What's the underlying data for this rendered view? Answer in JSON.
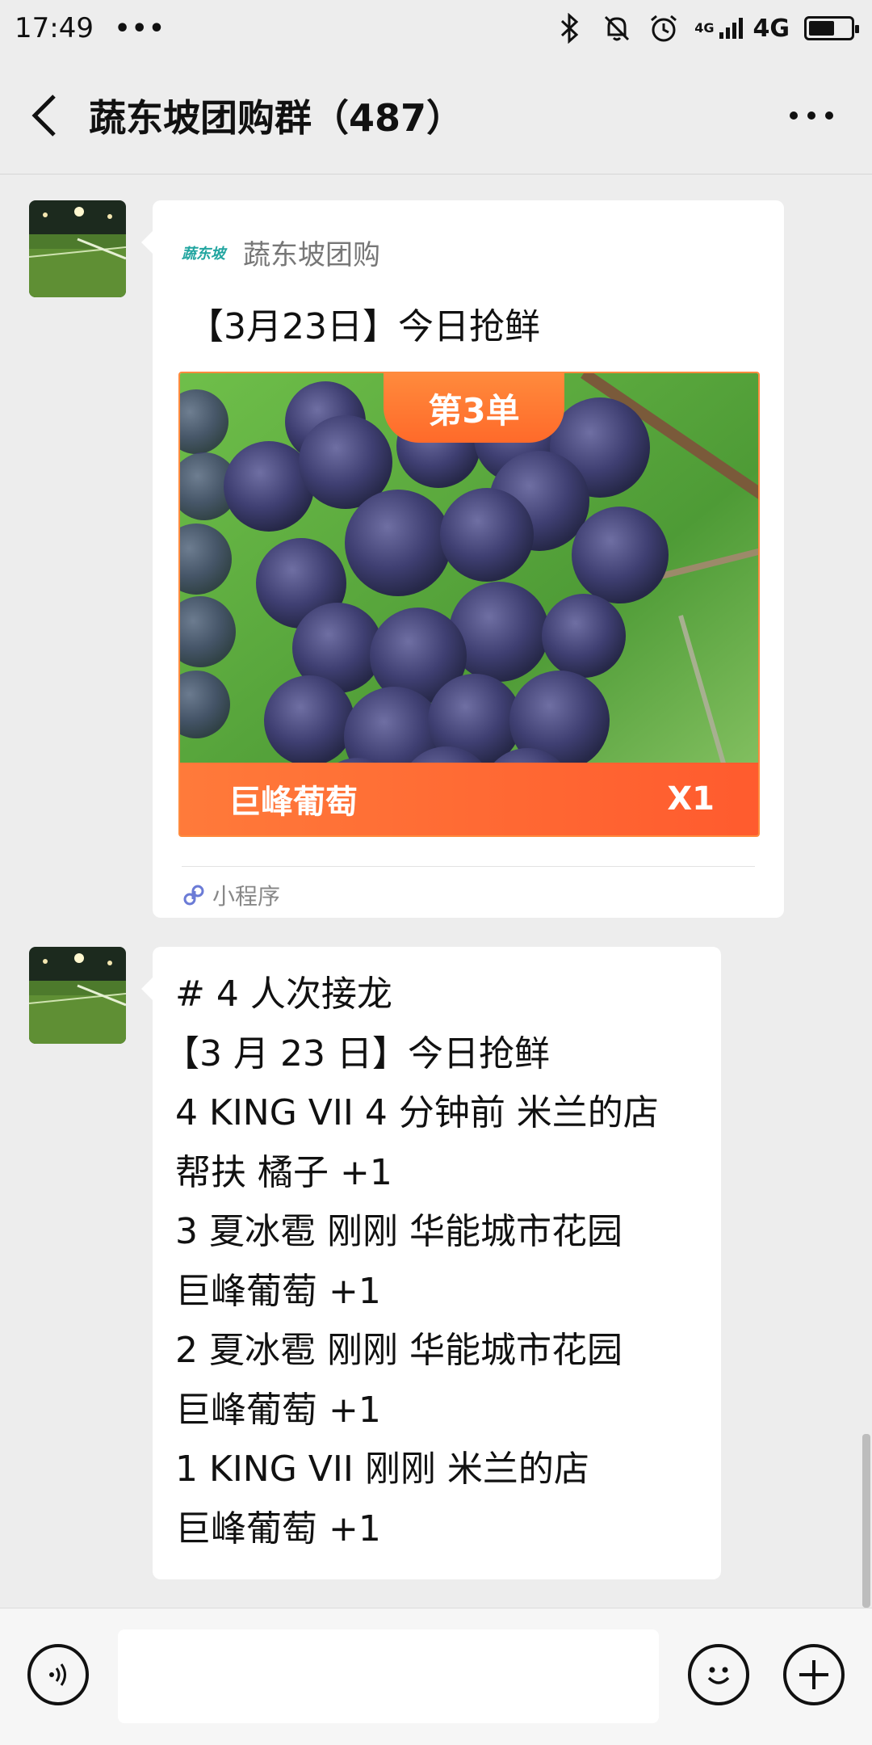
{
  "status_bar": {
    "time": "17:49",
    "dots": "•••",
    "network_small": "4G",
    "network": "4G"
  },
  "header": {
    "title": "蔬东坡团购群（487）"
  },
  "messages": [
    {
      "type": "mini_program_card",
      "logo_text": "蔬东坡",
      "source": "蔬东坡团购",
      "title": "【3月23日】今日抢鲜",
      "badge": "第3单",
      "product_name": "巨峰葡萄",
      "product_qty": "X1",
      "footer_label": "小程序"
    },
    {
      "type": "text",
      "lines": [
        "# 4 人次接龙",
        "【3 月 23 日】今日抢鲜",
        "4 KING VII 4 分钟前 米兰的店",
        "帮扶  橘子 +1",
        "3 夏冰雹 刚刚 华能城市花园",
        "巨峰葡萄 +1",
        "2 夏冰雹 刚刚 华能城市花园",
        "巨峰葡萄 +1",
        "1 KING VII 刚刚 米兰的店",
        "巨峰葡萄 +1"
      ]
    }
  ],
  "colors": {
    "background": "#ededed",
    "bubble": "#ffffff",
    "accent_orange": "#ff6a2a",
    "logo_teal": "#21a5a0"
  }
}
